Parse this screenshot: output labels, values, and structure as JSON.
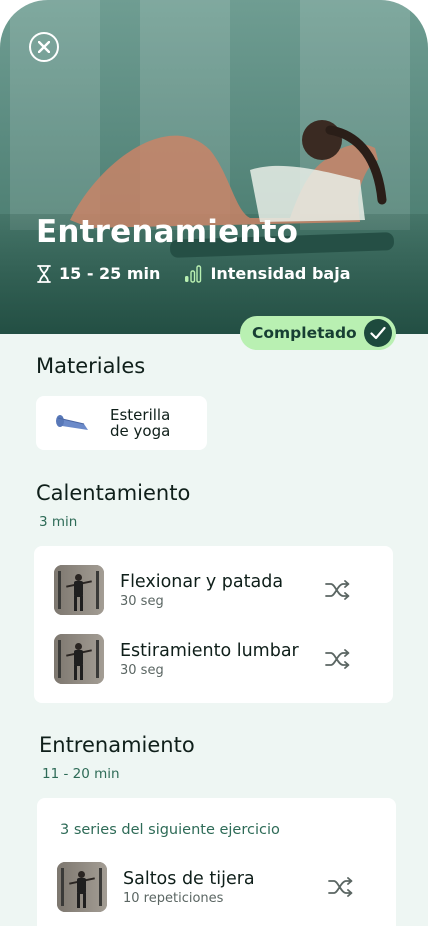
{
  "hero": {
    "title": "Entrenamiento",
    "duration": "15 - 25 min",
    "intensity": "Intensidad baja"
  },
  "status_badge": {
    "label": "Completado"
  },
  "materials": {
    "title": "Materiales",
    "items": [
      {
        "label": "Esterilla de yoga",
        "icon": "yoga-mat-icon"
      }
    ]
  },
  "warmup": {
    "title": "Calentamiento",
    "duration": "3 min",
    "exercises": [
      {
        "name": "Flexionar y patada",
        "detail": "30 seg"
      },
      {
        "name": "Estiramiento lumbar",
        "detail": "30 seg"
      }
    ]
  },
  "workout": {
    "title": "Entrenamiento",
    "duration": "11 - 20 min",
    "series_label": "3 series del siguiente ejercicio",
    "exercises": [
      {
        "name": "Saltos de tijera",
        "detail": "10 repeticiones"
      }
    ]
  },
  "colors": {
    "accent": "#2e6b57",
    "badge_bg": "#b9f0b2",
    "badge_check": "#1d4a3d",
    "page_bg": "#eef6f3"
  }
}
